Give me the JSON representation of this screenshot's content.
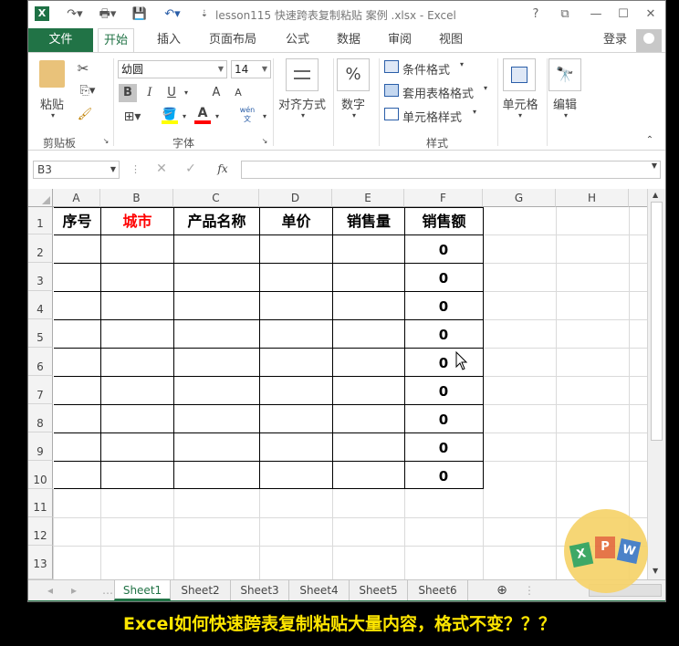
{
  "title": "lesson115 快速跨表复制粘贴 案例 .xlsx - Excel",
  "app_icon": "X",
  "window_buttons": [
    "?",
    "⧉",
    "—",
    "☐",
    "✕"
  ],
  "tabs": [
    {
      "label": "文件"
    },
    {
      "label": "开始"
    },
    {
      "label": "插入"
    },
    {
      "label": "页面布局"
    },
    {
      "label": "公式"
    },
    {
      "label": "数据"
    },
    {
      "label": "审阅"
    },
    {
      "label": "视图"
    }
  ],
  "login": "登录",
  "ribbon": {
    "clipboard": {
      "paste": "粘贴",
      "group": "剪贴板"
    },
    "font": {
      "name": "幼圆",
      "size": "14",
      "bold": "B",
      "italic": "I",
      "underline": "U",
      "group": "字体",
      "grow": "A",
      "shrink": "A",
      "color_a": "A",
      "wen": "wén\n文"
    },
    "align": {
      "label": "对齐方式"
    },
    "number": {
      "label": "数字",
      "icon": "%"
    },
    "styles": {
      "cond": "条件格式",
      "table": "套用表格格式",
      "cell": "单元格样式",
      "group": "样式"
    },
    "cells": {
      "label": "单元格"
    },
    "edit": {
      "label": "编辑"
    }
  },
  "namebox": "B3",
  "fx": "fx",
  "columns": [
    "A",
    "B",
    "C",
    "D",
    "E",
    "F",
    "G",
    "H"
  ],
  "rows": [
    "1",
    "2",
    "3",
    "4",
    "5",
    "6",
    "7",
    "8",
    "9",
    "10",
    "11",
    "12",
    "13"
  ],
  "headers": [
    {
      "text": "序号",
      "color": "#000000"
    },
    {
      "text": "城市",
      "color": "#ff0000"
    },
    {
      "text": "产品名称",
      "color": "#000000"
    },
    {
      "text": "单价",
      "color": "#000000"
    },
    {
      "text": "销售量",
      "color": "#000000"
    },
    {
      "text": "销售额",
      "color": "#000000"
    }
  ],
  "sales_values": [
    "0",
    "0",
    "0",
    "0",
    "0",
    "0",
    "0",
    "0",
    "0"
  ],
  "sheets": [
    "Sheet1",
    "Sheet2",
    "Sheet3",
    "Sheet4",
    "Sheet5",
    "Sheet6"
  ],
  "active_sheet": "Sheet1",
  "badge_letters": [
    "X",
    "P",
    "W"
  ],
  "caption": "Excel如何快速跨表复制粘贴大量内容，格式不变？？？",
  "colors": {
    "accent": "#217346",
    "caption": "#ffe600"
  }
}
